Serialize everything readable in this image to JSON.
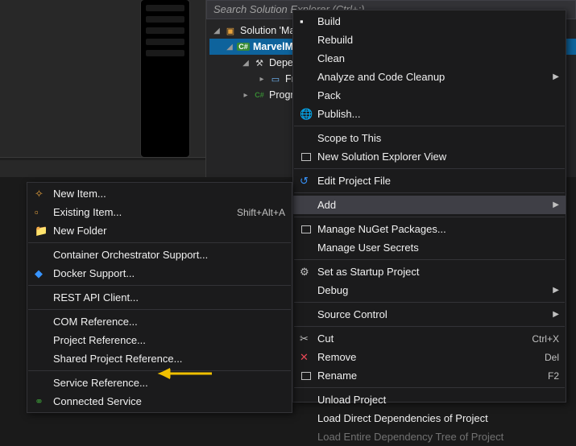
{
  "search": {
    "placeholder": "Search Solution Explorer (Ctrl+;)"
  },
  "tree": {
    "solution": "Solution 'Ma",
    "project": "MarvelM",
    "deps": "Deper",
    "frameworks": "Fra",
    "program": "Progra"
  },
  "menu": {
    "build": "Build",
    "rebuild": "Rebuild",
    "clean": "Clean",
    "analyze": "Analyze and Code Cleanup",
    "pack": "Pack",
    "publish": "Publish...",
    "scope": "Scope to This",
    "newview": "New Solution Explorer View",
    "editproj": "Edit Project File",
    "add": "Add",
    "nuget": "Manage NuGet Packages...",
    "secrets": "Manage User Secrets",
    "startup": "Set as Startup Project",
    "debug": "Debug",
    "sourcectrl": "Source Control",
    "cut": "Cut",
    "cut_short": "Ctrl+X",
    "remove": "Remove",
    "remove_short": "Del",
    "rename": "Rename",
    "rename_short": "F2",
    "unload": "Unload Project",
    "loaddeps": "Load Direct Dependencies of Project",
    "loadtree_partial": "Load Entire Dependency Tree of Project"
  },
  "submenu": {
    "newitem": "New Item...",
    "existing": "Existing Item...",
    "existing_short": "Shift+Alt+A",
    "newfolder": "New Folder",
    "orchestrator": "Container Orchestrator Support...",
    "docker": "Docker Support...",
    "restapi": "REST API Client...",
    "comref": "COM Reference...",
    "projref": "Project Reference...",
    "sharedref": "Shared Project Reference...",
    "serviceref": "Service Reference...",
    "connected": "Connected Service"
  }
}
